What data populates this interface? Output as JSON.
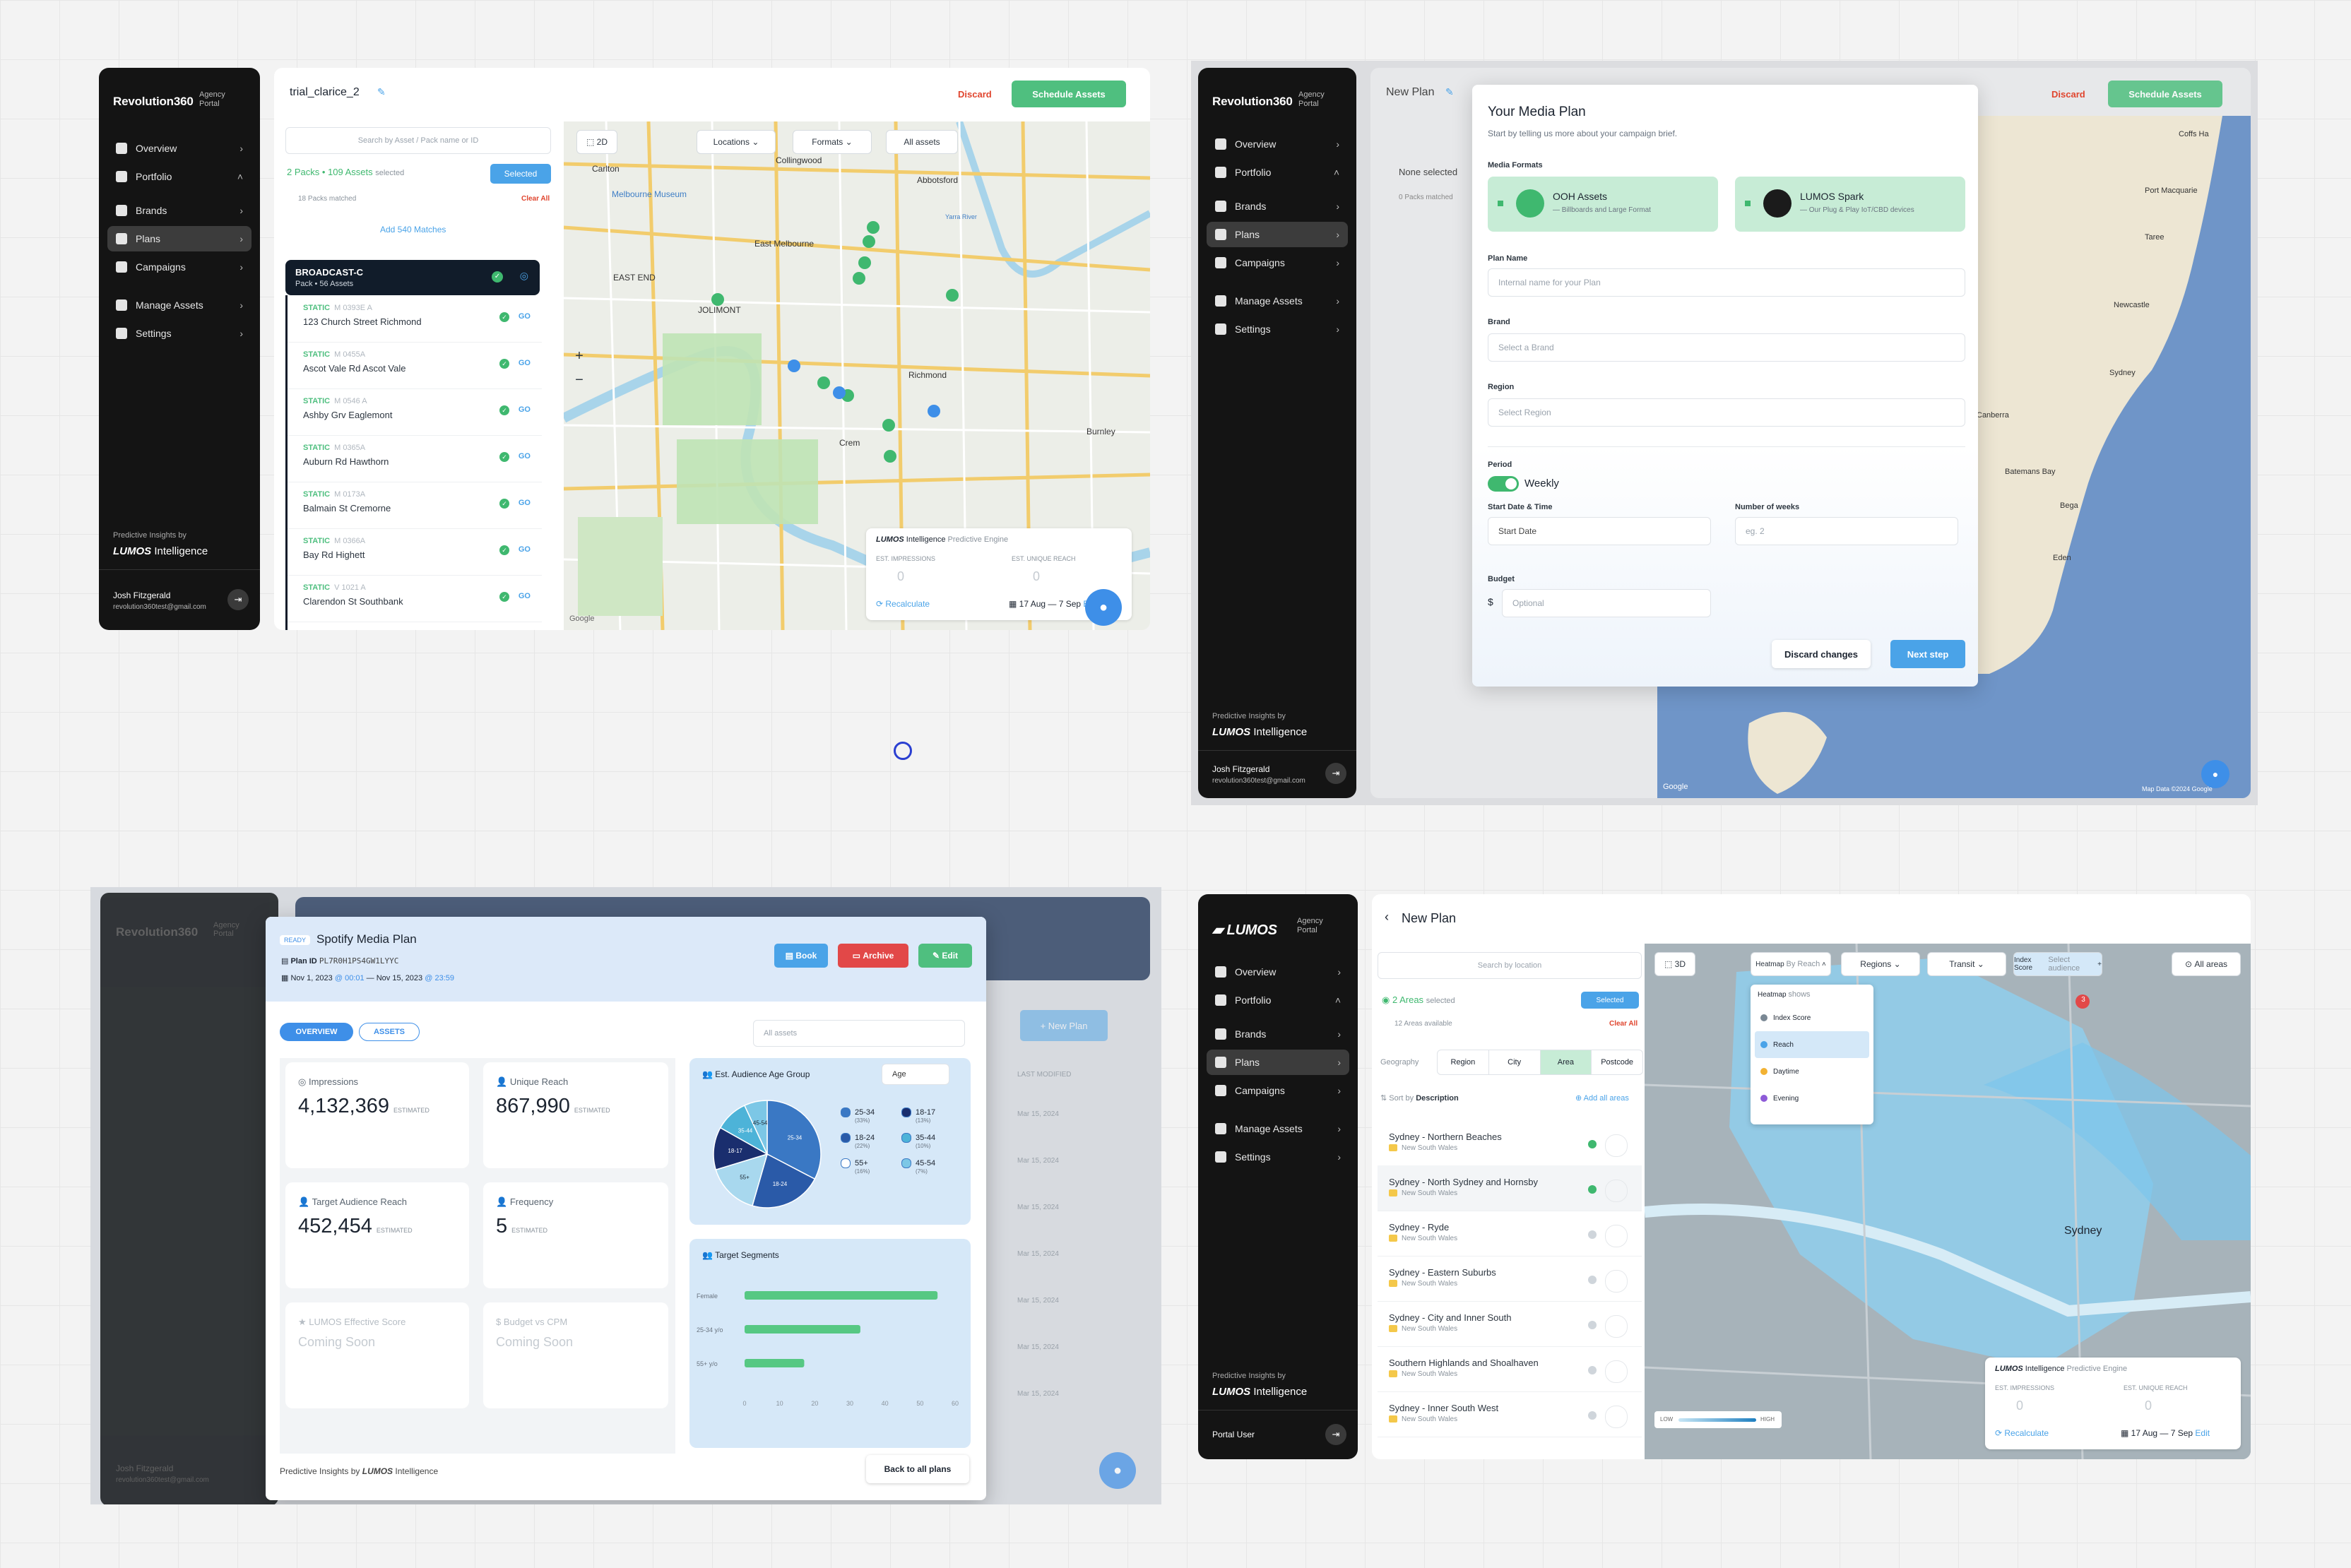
{
  "p1": {
    "brand": "Revolution360",
    "brand_sub": "Agency Portal",
    "nav": [
      "Overview",
      "Portfolio",
      "Brands",
      "Plans",
      "Campaigns",
      "Manage Assets",
      "Settings"
    ],
    "predictive": "Predictive Insights by",
    "lumos": "LUMOS",
    "intelligence": "Intelligence",
    "user": "Josh Fitzgerald",
    "email": "revolution360test@gmail.com",
    "plan_name": "trial_clarice_2",
    "discard": "Discard",
    "schedule": "Schedule Assets",
    "search_placeholder": "Search by Asset / Pack name or ID",
    "packs_count": "2 Packs • 109 Assets",
    "selected_word": "selected",
    "selected_btn": "Selected",
    "matched": "18 Packs",
    "matched_suffix": "matched",
    "clear_all": "Clear All",
    "add_matches": "Add 540 Matches",
    "pack_name": "BROADCAST-C",
    "pack_meta": "Pack • 56 Assets",
    "rows": [
      {
        "code": "M 0393E A",
        "name": "123 Church Street Richmond"
      },
      {
        "code": "M 0455A",
        "name": "Ascot Vale Rd Ascot Vale"
      },
      {
        "code": "M 0546 A",
        "name": "Ashby Grv Eaglemont"
      },
      {
        "code": "M 0365A",
        "name": "Auburn Rd Hawthorn"
      },
      {
        "code": "M 0173A",
        "name": "Balmain St Cremorne"
      },
      {
        "code": "M 0366A",
        "name": "Bay Rd Highett"
      },
      {
        "code": "V 1021 A",
        "name": "Clarendon St Southbank"
      }
    ],
    "static": "STATIC",
    "go": "GO",
    "chips": [
      "2D",
      "Locations",
      "Formats",
      "All assets"
    ],
    "places": [
      "Carlton",
      "Collingwood",
      "Abbotsford",
      "Melbourne Museum",
      "East Melbourne",
      "EAST END",
      "JOLIMONT",
      "Richmond",
      "Crem",
      "Burnley",
      "Yarra River"
    ],
    "pred_engine": "Predictive Engine",
    "est_impr": "EST. IMPRESSIONS",
    "est_reach": "EST. UNIQUE REACH",
    "zero": "0",
    "recalc": "Recalculate",
    "dates": "17 Aug — 7 Sep",
    "edit": "Edit",
    "google": "Google"
  },
  "p2": {
    "brand": "Revolution360",
    "brand_sub": "Agency Portal",
    "nav": [
      "Overview",
      "Portfolio",
      "Brands",
      "Plans",
      "Campaigns",
      "Manage Assets",
      "Settings"
    ],
    "predictive": "Predictive Insights by",
    "lumos": "LUMOS",
    "intelligence": "Intelligence",
    "user": "Josh Fitzgerald",
    "email": "revolution360test@gmail.com",
    "plan_name": "New Plan",
    "discard": "Discard",
    "schedule": "Schedule Assets",
    "none_selected": "None selected",
    "packs_matched": "0 Packs matched",
    "modal": {
      "title": "Your Media Plan",
      "subtitle": "Start by telling us more about your campaign brief.",
      "formats_label": "Media Formats",
      "ooh": "OOH Assets",
      "ooh_sub": "— Billboards and Large Format",
      "spark": "LUMOS Spark",
      "spark_sub": "— Our Plug & Play IoT/CBD devices",
      "plan_name_label": "Plan Name",
      "plan_name_ph": "Internal name for your Plan",
      "brand_label": "Brand",
      "brand_ph": "Select a Brand",
      "region_label": "Region",
      "region_ph": "Select Region",
      "period_label": "Period",
      "weekly": "Weekly",
      "start_label": "Start Date & Time",
      "start_ph": "Start Date",
      "weeks_label": "Number of weeks",
      "weeks_ph": "eg. 2",
      "budget_label": "Budget",
      "currency": "$",
      "budget_ph": "Optional",
      "discard_changes": "Discard changes",
      "next": "Next step"
    },
    "places": [
      "Coffs Ha",
      "Port Macquarie",
      "Taree",
      "Newcastle",
      "Sydney",
      "Canberra",
      "Batemans Bay",
      "Bega",
      "Eden"
    ],
    "map_footer": "Map Data ©2024 Google",
    "google": "Google"
  },
  "p3": {
    "brand": "Revolution360",
    "brand_sub": "Agency Portal",
    "ready": "READY",
    "title": "Spotify Media Plan",
    "plan_id_label": "Plan ID",
    "plan_id": "PL7R0H1PS4GW1LYYC",
    "dates_a": "Nov 1, 2023",
    "time_a": "@ 00:01",
    "dates_b": "— Nov 15, 2023",
    "time_b": "@ 23:59",
    "book": "Book",
    "archive": "Archive",
    "edit": "Edit",
    "tab_overview": "OVERVIEW",
    "tab_assets": "ASSETS",
    "all_assets": "All assets",
    "impressions_label": "Impressions",
    "impressions": "4,132,369",
    "reach_label": "Unique Reach",
    "reach": "867,990",
    "target_label": "Target Audience Reach",
    "target": "452,454",
    "freq_label": "Frequency",
    "freq": "5",
    "estimated": "ESTIMATED",
    "lumos_score": "LUMOS Effective Score",
    "budget_cpm": "Budget vs CPM",
    "coming": "Coming Soon",
    "age_label": "Est. Audience Age Group",
    "age_select": "Age",
    "segments_label": "Target Segments",
    "predictive": "Predictive Insights by",
    "lumos": "LUMOS",
    "intelligence": "Intelligence",
    "back": "Back to all plans",
    "new_plan": "+ New Plan",
    "last_modified": "LAST MODIFIED",
    "rows": [
      "Mar 15, 2024",
      "Mar 15, 2024",
      "Mar 15, 2024",
      "Mar 15, 2024",
      "Mar 15, 2024",
      "Mar 15, 2024",
      "Mar 15, 2024"
    ],
    "user": "Josh Fitzgerald",
    "email": "revolution360test@gmail.com"
  },
  "age_chart": {
    "type": "pie",
    "slices": [
      {
        "label": "25-34",
        "pct": 33,
        "color": "#3a78c4"
      },
      {
        "label": "18-24",
        "pct": 22,
        "color": "#2a5aa8"
      },
      {
        "label": "55+",
        "pct": 16,
        "color": "#a8d8ee"
      },
      {
        "label": "18-17",
        "pct": 13,
        "color": "#1a2e6e"
      },
      {
        "label": "35-44",
        "pct": 10,
        "color": "#4db3d8"
      },
      {
        "label": "45-54",
        "pct": 7,
        "color": "#7cc7e6"
      }
    ],
    "legend": [
      {
        "label": "25-34",
        "pct": "(33%)",
        "color": "#3a78c4"
      },
      {
        "label": "18-17",
        "pct": "(13%)",
        "color": "#1a2e6e"
      },
      {
        "label": "18-24",
        "pct": "(22%)",
        "color": "#2a5aa8"
      },
      {
        "label": "35-44",
        "pct": "(10%)",
        "color": "#4db3d8"
      },
      {
        "label": "55+",
        "pct": "(16%)",
        "color": "#ffffff"
      },
      {
        "label": "45-54",
        "pct": "(7%)",
        "color": "#7cc7e6"
      }
    ]
  },
  "chart_data": {
    "type": "bar",
    "orientation": "horizontal",
    "categories": [
      "Female",
      "25-34 y/o",
      "55+ y/o"
    ],
    "values": [
      55,
      33,
      17
    ],
    "xlim": [
      0,
      60
    ],
    "xticks": [
      "0",
      "10",
      "20",
      "30",
      "40",
      "50",
      "60"
    ]
  },
  "p4": {
    "brand": "LUMOS",
    "brand_sub": "Agency Portal",
    "nav": [
      "Overview",
      "Portfolio",
      "Brands",
      "Plans",
      "Campaigns",
      "Manage Assets",
      "Settings"
    ],
    "predictive": "Predictive Insights by",
    "lumos": "LUMOS",
    "intelligence": "Intelligence",
    "user": "Portal User",
    "title": "New Plan",
    "search_ph": "Search by location",
    "areas": "2 Areas",
    "areas_selected": "selected",
    "selected_btn": "Selected",
    "available": "12 Areas available",
    "clear_all": "Clear All",
    "geo_label": "Geography",
    "geo_tabs": [
      "Region",
      "City",
      "Area",
      "Postcode"
    ],
    "sort": "Sort by",
    "sort_val": "Description",
    "add_all": "Add all areas",
    "list": [
      {
        "name": "Sydney - Northern Beaches",
        "state": "New South Wales",
        "on": true
      },
      {
        "name": "Sydney - North Sydney and Hornsby",
        "state": "New South Wales",
        "on": true
      },
      {
        "name": "Sydney - Ryde",
        "state": "New South Wales",
        "on": false
      },
      {
        "name": "Sydney - Eastern Suburbs",
        "state": "New South Wales",
        "on": false
      },
      {
        "name": "Sydney - City and Inner South",
        "state": "New South Wales",
        "on": false
      },
      {
        "name": "Southern Highlands and Shoalhaven",
        "state": "New South Wales",
        "on": false
      },
      {
        "name": "Sydney - Inner South West",
        "state": "New South Wales",
        "on": false
      }
    ],
    "chips": [
      "3D",
      "Heatmap",
      "Regions",
      "Transit",
      "Index Score",
      "All areas"
    ],
    "heatmap_sub": "By Reach",
    "index_sub": "Select audience",
    "heat_menu": [
      "Index Score",
      "Reach",
      "Daytime",
      "Evening"
    ],
    "heat_menu_title": "Heatmap",
    "heat_menu_sub": "shows",
    "pred_engine": "Predictive Engine",
    "est_impr": "EST. IMPRESSIONS",
    "est_reach": "EST. UNIQUE REACH",
    "zero": "0",
    "recalc": "Recalculate",
    "dates": "17 Aug — 7 Sep",
    "edit": "Edit",
    "sydney": "Sydney",
    "badge": "3",
    "low": "LOW",
    "high": "HIGH"
  }
}
